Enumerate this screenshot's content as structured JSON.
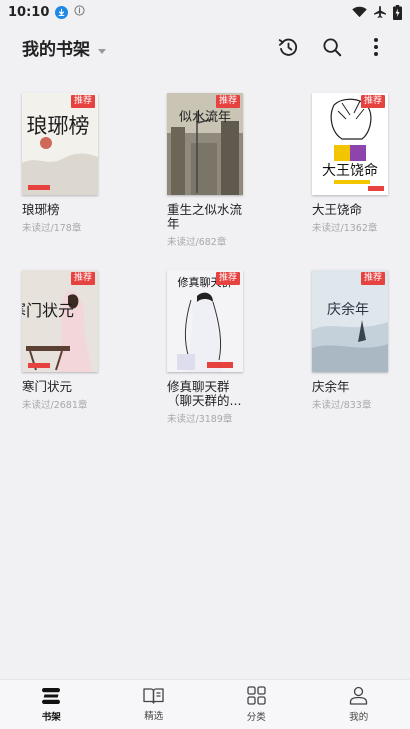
{
  "status_bar": {
    "time": "10:10"
  },
  "header": {
    "title": "我的书架",
    "icons": [
      "history-icon",
      "search-icon",
      "more-vertical-icon"
    ]
  },
  "books": [
    {
      "title": "琅琊榜",
      "progress": "未读过/178章",
      "badge": "推荐",
      "cover_text": "琅琊榜"
    },
    {
      "title": "重生之似水流年",
      "progress": "未读过/682章",
      "badge": "推荐",
      "cover_text": "似水流年"
    },
    {
      "title": "大王饶命",
      "progress": "未读过/1362章",
      "badge": "推荐",
      "cover_text": "大王饶命"
    },
    {
      "title": "寒门状元",
      "progress": "未读过/2681章",
      "badge": "推荐",
      "cover_text": "寒门状元"
    },
    {
      "title": "修真聊天群（聊天群的...",
      "progress": "未读过/3189章",
      "badge": "推荐",
      "cover_text": "修真聊天群"
    },
    {
      "title": "庆余年",
      "progress": "未读过/833章",
      "badge": "推荐",
      "cover_text": "庆余年"
    }
  ],
  "bottom_nav": [
    {
      "label": "书架",
      "icon": "bookshelf-icon",
      "active": true
    },
    {
      "label": "精选",
      "icon": "open-book-icon",
      "active": false
    },
    {
      "label": "分类",
      "icon": "grid-icon",
      "active": false
    },
    {
      "label": "我的",
      "icon": "user-icon",
      "active": false
    }
  ],
  "colors": {
    "background": "#f1f1f4",
    "badge": "#e64340",
    "progress_text": "#a8a8a8"
  }
}
